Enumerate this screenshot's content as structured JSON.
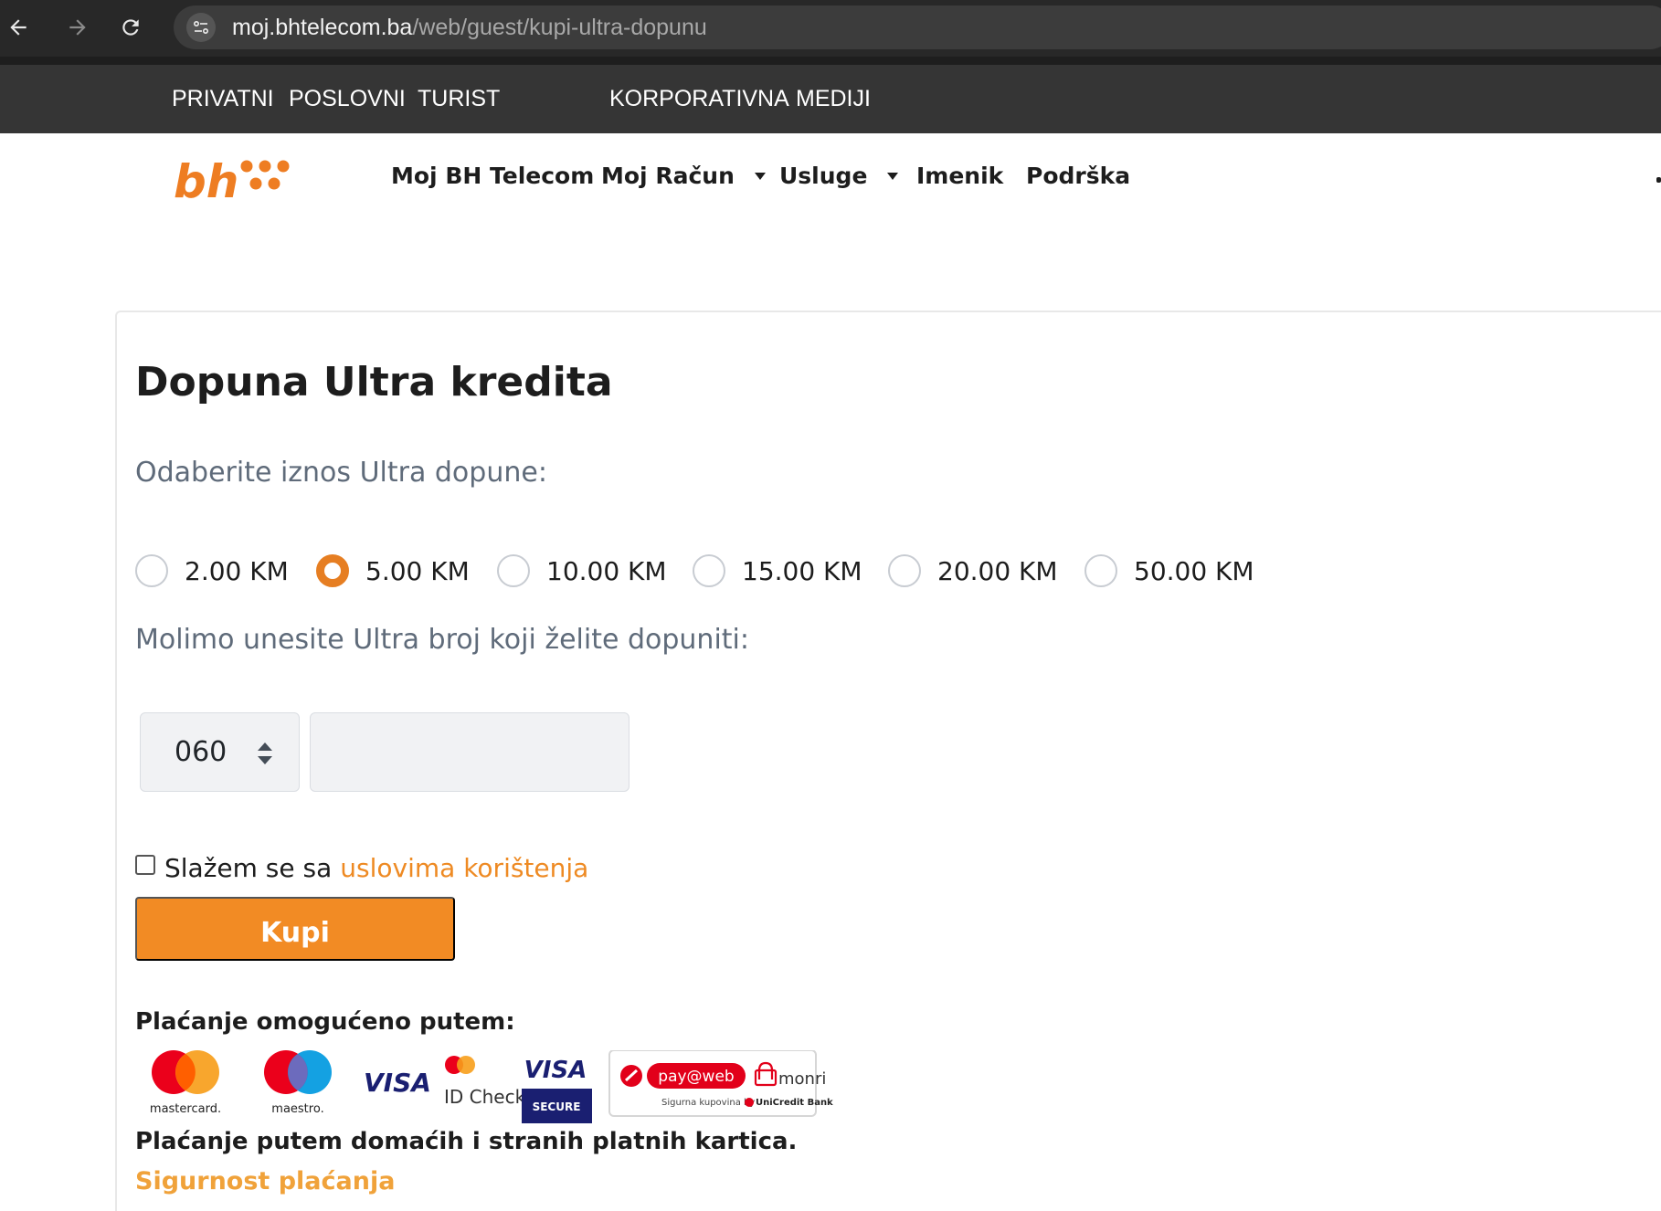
{
  "browser": {
    "url_host": "moj.bhtelecom.ba",
    "url_path": "/web/guest/kupi-ultra-dopunu"
  },
  "topbar": {
    "items": [
      "PRIVATNI",
      "POSLOVNI",
      "TURIST",
      "KORPORATIVNA",
      "MEDIJI"
    ]
  },
  "header": {
    "logo_text": "bh",
    "brand_color": "#ee7d22",
    "nav": [
      {
        "label": "Moj BH Telecom",
        "dropdown": false
      },
      {
        "label": "Moj Račun",
        "dropdown": true
      },
      {
        "label": "Usluge",
        "dropdown": true
      },
      {
        "label": "Imenik",
        "dropdown": false
      },
      {
        "label": "Podrška",
        "dropdown": false
      }
    ]
  },
  "form": {
    "title": "Dopuna Ultra kredita",
    "amount_prompt": "Odaberite iznos Ultra dopune:",
    "amounts": [
      "2.00 KM",
      "5.00 KM",
      "10.00 KM",
      "15.00 KM",
      "20.00 KM",
      "50.00 KM"
    ],
    "selected_amount": "5.00 KM",
    "number_prompt": "Molimo unesite Ultra broj koji želite dopuniti:",
    "prefix_value": "060",
    "phone_value": "",
    "terms_prefix": "Slažem se sa",
    "terms_link": "uslovima korištenja",
    "terms_checked": false,
    "submit_label": "Kupi",
    "accent_color": "#f28b24"
  },
  "payment": {
    "label": "Plaćanje omogućeno putem:",
    "logos": {
      "mastercard": "mastercard.",
      "maestro": "maestro.",
      "visa": "VISA",
      "idcheck": "ID Check",
      "visa_secure_top": "VISA",
      "visa_secure_bottom": "SECURE",
      "payweb": "pay@web",
      "monri": "monri",
      "payweb_sub": "Sigurna kupovina by",
      "unicredit": "UniCredit Bank"
    },
    "note": "Plaćanje putem domaćih i stranih platnih kartica.",
    "security_link": "Sigurnost plaćanja"
  }
}
